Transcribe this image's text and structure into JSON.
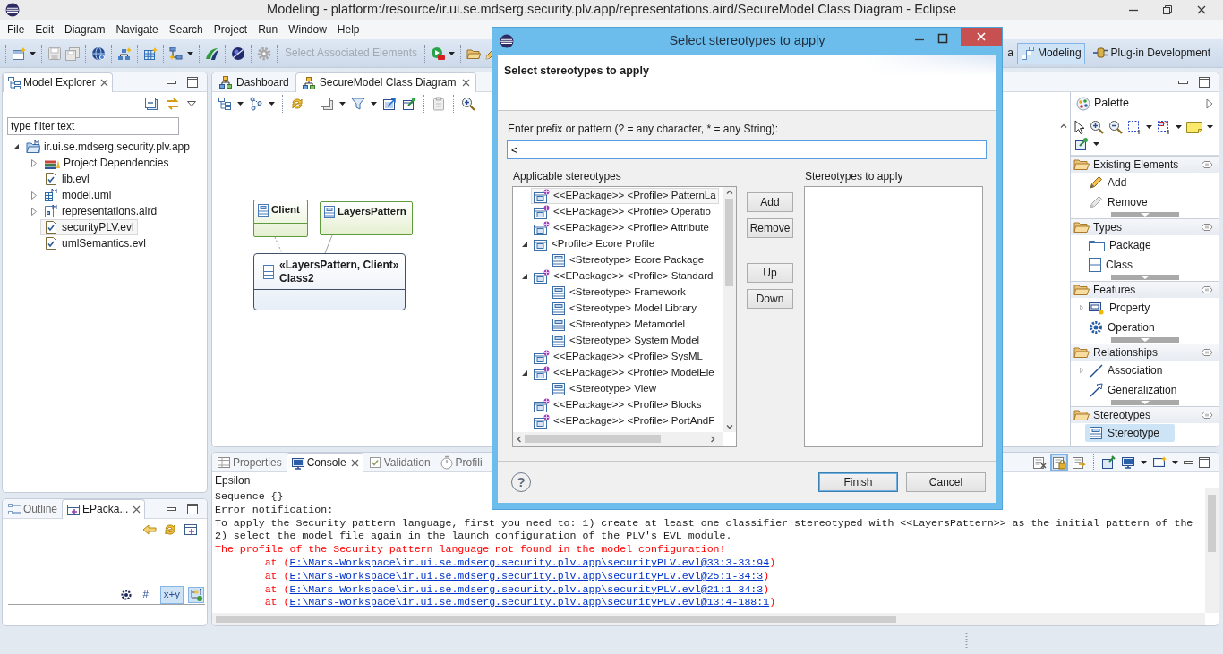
{
  "window": {
    "title": "Modeling - platform:/resource/ir.ui.se.mdserg.security.plv.app/representations.aird/SecureModel Class Diagram - Eclipse"
  },
  "menu": [
    "File",
    "Edit",
    "Diagram",
    "Navigate",
    "Search",
    "Project",
    "Run",
    "Window",
    "Help"
  ],
  "toolbar": {
    "select_associated": {
      "label": "Select Associated Elements",
      "disabled": true
    }
  },
  "perspectives": [
    {
      "label": "a",
      "selected": false
    },
    {
      "label": "Modeling",
      "selected": true
    },
    {
      "label": "Plug-in Development",
      "selected": false
    }
  ],
  "model_explorer": {
    "tab": {
      "label": "Model Explorer",
      "selected": true
    },
    "filter": {
      "placeholder": "type filter text"
    },
    "tree": [
      {
        "label": "ir.ui.se.mdserg.security.plv.app",
        "kind": "project",
        "expanded": true,
        "selected": false,
        "children": [
          {
            "label": "Project Dependencies",
            "kind": "library",
            "expanded": false,
            "selected": false
          },
          {
            "label": "lib.evl",
            "kind": "evl",
            "selected": false
          },
          {
            "label": "model.uml",
            "kind": "uml",
            "expanded": false,
            "selected": false
          },
          {
            "label": "representations.aird",
            "kind": "aird",
            "expanded": false,
            "selected": false
          },
          {
            "label": "securityPLV.evl",
            "kind": "evl",
            "selected": true
          },
          {
            "label": "umlSemantics.evl",
            "kind": "evl",
            "selected": false
          }
        ]
      }
    ]
  },
  "outline": {
    "tabs": [
      {
        "label": "Outline",
        "selected": false
      },
      {
        "label": "EPacka...",
        "selected": true
      }
    ],
    "toggles": [
      {
        "kind": "icon",
        "pressed": false
      },
      {
        "kind": "text",
        "label": "#",
        "pressed": false
      },
      {
        "kind": "text",
        "label": "x+y",
        "pressed": true
      },
      {
        "kind": "icon",
        "pressed": true
      }
    ]
  },
  "editor": {
    "tabs": [
      {
        "label": "Dashboard",
        "selected": false
      },
      {
        "label": "SecureModel Class Diagram",
        "selected": true
      }
    ],
    "nodes": [
      {
        "kind": "stereotype",
        "label": "Client"
      },
      {
        "kind": "stereotype",
        "label": "LayersPattern"
      },
      {
        "kind": "class",
        "stereotypes": "«LayersPattern, Client»",
        "label": "Class2"
      }
    ],
    "palette": {
      "title": "Palette",
      "drawers": [
        {
          "label": "Existing Elements",
          "scrollable": true,
          "items": [
            {
              "kind": "add",
              "label": "Add",
              "selected": false
            },
            {
              "kind": "remove",
              "label": "Remove",
              "selected": false
            }
          ]
        },
        {
          "label": "Types",
          "scrollable": true,
          "items": [
            {
              "kind": "package",
              "label": "Package",
              "selected": false
            },
            {
              "kind": "class",
              "label": "Class",
              "selected": false
            }
          ]
        },
        {
          "label": "Features",
          "scrollable": true,
          "items": [
            {
              "kind": "property",
              "label": "Property",
              "selected": false,
              "expanded": false
            },
            {
              "kind": "operation",
              "label": "Operation",
              "selected": false
            }
          ]
        },
        {
          "label": "Relationships",
          "scrollable": true,
          "items": [
            {
              "kind": "association",
              "label": "Association",
              "selected": false,
              "expanded": false
            },
            {
              "kind": "generalization",
              "label": "Generalization",
              "selected": false
            }
          ]
        },
        {
          "label": "Stereotypes",
          "scrollable": false,
          "items": [
            {
              "kind": "stereotype",
              "label": "Stereotype",
              "selected": true
            }
          ]
        }
      ]
    }
  },
  "console": {
    "tabs": [
      {
        "label": "Properties",
        "selected": false
      },
      {
        "label": "Console",
        "selected": true
      },
      {
        "label": "Validation",
        "selected": false
      },
      {
        "label": "Profili",
        "selected": false
      }
    ],
    "toggles": [
      {
        "pressed": false
      },
      {
        "pressed": true
      },
      {
        "pressed": false
      }
    ],
    "name": "Epsilon",
    "lines": [
      {
        "kind": "normal",
        "text": "Sequence {}"
      },
      {
        "kind": "normal",
        "text": "Error notification:"
      },
      {
        "kind": "normal",
        "text": "To apply the Security pattern language, first you need to: 1) create at least one classifier stereotyped with <<LayersPattern>> as the initial pattern of the"
      },
      {
        "kind": "normal",
        "text": "2) select the model file again in the launch configuration of the PLV's EVL module."
      },
      {
        "kind": "error",
        "text": "The profile of the Security pattern language not found in the model configuration!"
      },
      {
        "kind": "trace",
        "prefix": "at (",
        "link": "E:\\Mars-Workspace\\ir.ui.se.mdserg.security.plv.app\\securityPLV.evl@33:3-33:94",
        "suffix": ")"
      },
      {
        "kind": "trace",
        "prefix": "at (",
        "link": "E:\\Mars-Workspace\\ir.ui.se.mdserg.security.plv.app\\securityPLV.evl@25:1-34:3",
        "suffix": ")"
      },
      {
        "kind": "trace",
        "prefix": "at (",
        "link": "E:\\Mars-Workspace\\ir.ui.se.mdserg.security.plv.app\\securityPLV.evl@21:1-34:3",
        "suffix": ")"
      },
      {
        "kind": "trace",
        "prefix": "at (",
        "link": "E:\\Mars-Workspace\\ir.ui.se.mdserg.security.plv.app\\securityPLV.evl@13:4-188:1",
        "suffix": ")"
      }
    ]
  },
  "dialog": {
    "title": "Select stereotypes to apply",
    "heading": "Select stereotypes to apply",
    "pattern": {
      "label": "Enter prefix or pattern (? = any character, * = any String):",
      "value": "<"
    },
    "applicable": {
      "label": "Applicable stereotypes",
      "tree": [
        {
          "label": "<<EPackage>> <Profile> PatternLa",
          "kind": "epackage",
          "selected": true
        },
        {
          "label": "<<EPackage>> <Profile> Operatio",
          "kind": "epackage",
          "selected": false
        },
        {
          "label": "<<EPackage>> <Profile> Attribute",
          "kind": "epackage",
          "selected": false
        },
        {
          "label": "<Profile> Ecore Profile",
          "kind": "profile",
          "expanded": true,
          "selected": false,
          "children": [
            {
              "label": "<Stereotype> Ecore Package",
              "kind": "stereotype",
              "selected": false
            }
          ]
        },
        {
          "label": "<<EPackage>> <Profile> Standard",
          "kind": "epackage",
          "expanded": true,
          "selected": false,
          "children": [
            {
              "label": "<Stereotype> Framework",
              "kind": "stereotype",
              "selected": false
            },
            {
              "label": "<Stereotype> Model Library",
              "kind": "stereotype",
              "selected": false
            },
            {
              "label": "<Stereotype> Metamodel",
              "kind": "stereotype",
              "selected": false
            },
            {
              "label": "<Stereotype> System Model",
              "kind": "stereotype",
              "selected": false
            }
          ]
        },
        {
          "label": "<<EPackage>> <Profile> SysML",
          "kind": "epackage",
          "selected": false
        },
        {
          "label": "<<EPackage>> <Profile> ModelEle",
          "kind": "epackage",
          "expanded": true,
          "selected": false,
          "children": [
            {
              "label": "<Stereotype> View",
              "kind": "stereotype",
              "selected": false
            }
          ]
        },
        {
          "label": "<<EPackage>> <Profile> Blocks",
          "kind": "epackage",
          "selected": false
        },
        {
          "label": "<<EPackage>> <Profile> PortAndF",
          "kind": "epackage",
          "selected": false
        }
      ]
    },
    "side_buttons": [
      "Add",
      "Remove",
      "Up",
      "Down"
    ],
    "to_apply": {
      "label": "Stereotypes to apply"
    },
    "help": "?",
    "buttons": [
      {
        "label": "Finish",
        "default": true
      },
      {
        "label": "Cancel",
        "default": false
      }
    ]
  }
}
